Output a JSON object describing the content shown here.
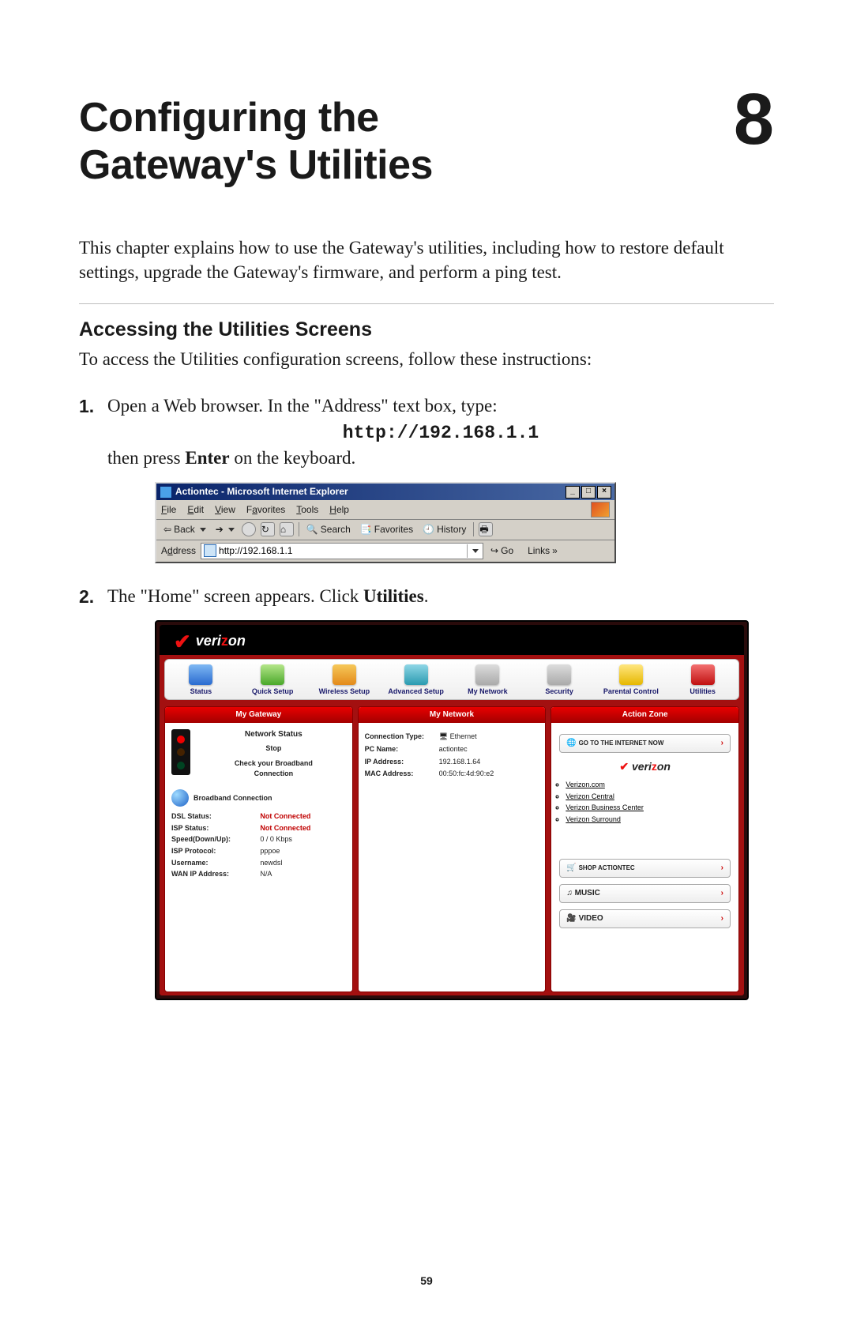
{
  "chapter": {
    "title_line1": "Configuring the",
    "title_line2": "Gateway's Utilities",
    "number": "8"
  },
  "intro": "This chapter explains how to use the Gateway's utilities, including how to restore default settings, upgrade the Gateway's firmware, and perform a ping test.",
  "section": {
    "title": "Accessing the Utilities Screens",
    "intro": "To access the Utilities configuration screens, follow these instructions:"
  },
  "steps": {
    "step1": {
      "part_a": "Open a Web browser. In the \"Address\" text box, type:",
      "url": "http://192.168.1.1",
      "part_b_pre": "then press ",
      "part_b_bold": "Enter",
      "part_b_post": " on the keyboard."
    },
    "step2": {
      "pre": "The \"Home\" screen appears. Click ",
      "bold": "Utilities",
      "post": "."
    }
  },
  "ie_window": {
    "title": "Actiontec - Microsoft Internet Explorer",
    "buttons": {
      "min": "_",
      "max": "□",
      "close": "×"
    },
    "menus": {
      "file": "File",
      "edit": "Edit",
      "view": "View",
      "favorites": "Favorites",
      "tools": "Tools",
      "help": "Help"
    },
    "toolbar": {
      "back": "Back",
      "search": "Search",
      "favorites": "Favorites",
      "history": "History"
    },
    "addressbar": {
      "label": "Address",
      "value": "http://192.168.1.1",
      "go": "Go",
      "links": "Links"
    }
  },
  "vz": {
    "brand": {
      "pre": "veri",
      "accent": "z",
      "post": "on"
    },
    "nav": [
      {
        "label": "Status",
        "icon": "blue"
      },
      {
        "label": "Quick Setup",
        "icon": "green"
      },
      {
        "label": "Wireless Setup",
        "icon": "orange"
      },
      {
        "label": "Advanced Setup",
        "icon": "teal"
      },
      {
        "label": "My Network",
        "icon": "gray"
      },
      {
        "label": "Security",
        "icon": "gray"
      },
      {
        "label": "Parental Control",
        "icon": "yellow"
      },
      {
        "label": "Utilities",
        "icon": "red"
      }
    ],
    "panels": {
      "my_gateway": {
        "title": "My Gateway",
        "network_status_label": "Network Status",
        "stop": "Stop",
        "check_line1": "Check your Broadband",
        "check_line2": "Connection",
        "broadband_conn": "Broadband Connection",
        "rows": [
          {
            "k": "DSL Status:",
            "v": "Not Connected",
            "red": true
          },
          {
            "k": "ISP Status:",
            "v": "Not Connected",
            "red": true
          },
          {
            "k": "Speed(Down/Up):",
            "v": "0 / 0 Kbps",
            "red": false
          },
          {
            "k": "ISP Protocol:",
            "v": "pppoe",
            "red": false
          },
          {
            "k": "Username:",
            "v": "newdsl",
            "red": false
          },
          {
            "k": "WAN IP Address:",
            "v": "N/A",
            "red": false
          }
        ]
      },
      "my_network": {
        "title": "My Network",
        "rows": [
          {
            "k": "Connection Type:",
            "v": "Ethernet"
          },
          {
            "k": "PC Name:",
            "v": "actiontec"
          },
          {
            "k": "IP Address:",
            "v": "192.168.1.64"
          },
          {
            "k": "MAC Address:",
            "v": "00:50:fc:4d:90:e2"
          }
        ]
      },
      "action_zone": {
        "title": "Action Zone",
        "go_internet": "GO TO THE INTERNET NOW",
        "links": [
          "Verizon.com",
          "Verizon Central",
          "Verizon Business Center",
          "Verizon Surround"
        ],
        "buttons": {
          "shop": "SHOP ACTIONTEC",
          "music": "MUSIC",
          "video": "VIDEO"
        }
      }
    }
  },
  "page_number": "59"
}
